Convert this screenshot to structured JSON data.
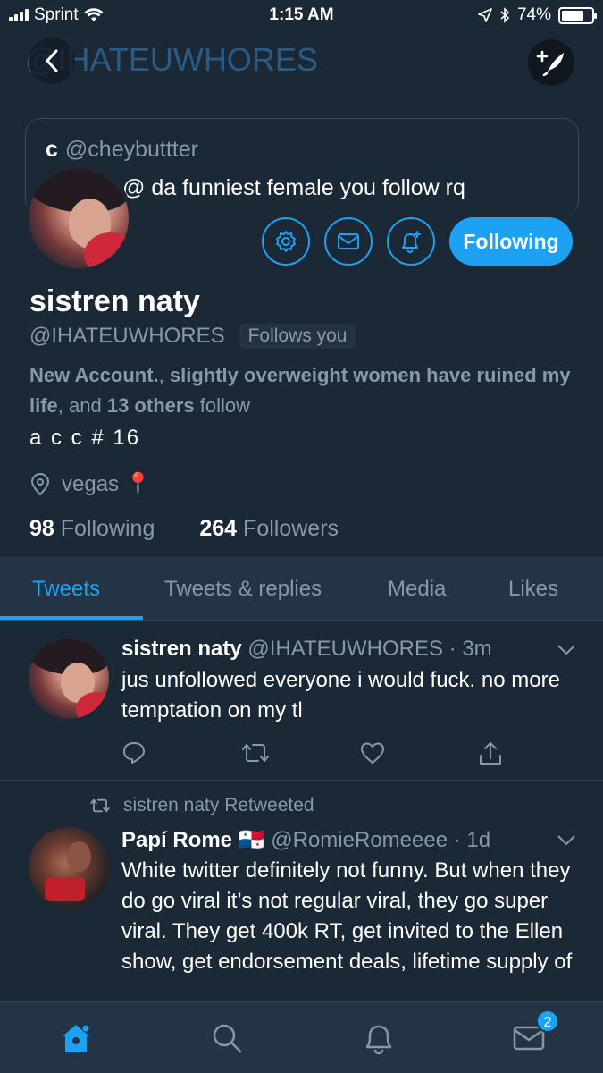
{
  "status_bar": {
    "carrier": "Sprint",
    "time": "1:15 AM",
    "battery": "74%",
    "battery_level": 0.74
  },
  "header": {
    "banner_handle": "@IHATEUWHORES",
    "quote": {
      "name": "c",
      "handle": "@cheybuttter",
      "text": "@ da funniest female you follow rq"
    }
  },
  "profile": {
    "name": "sistren naty",
    "handle": "@IHATEUWHORES",
    "follows_you": "Follows you",
    "followed_by_1": "New Account.",
    "followed_by_sep1": ", ",
    "followed_by_2": "slightly overweight women have ruined my life",
    "followed_by_sep2": ", and ",
    "followed_by_3": "13 others",
    "followed_by_suffix": " follow",
    "bio": "a c c # 16",
    "location": "vegas 📍",
    "following_count": "98",
    "following_label": "Following",
    "followers_count": "264",
    "followers_label": "Followers",
    "following_button": "Following"
  },
  "tabs": [
    {
      "label": "Tweets",
      "active": true
    },
    {
      "label": "Tweets & replies",
      "active": false
    },
    {
      "label": "Media",
      "active": false
    },
    {
      "label": "Likes",
      "active": false
    }
  ],
  "tweets": [
    {
      "name": "sistren naty",
      "handle": "@IHATEUWHORES",
      "time": "3m",
      "text": "jus unfollowed everyone i would fuck. no more temptation on my tl"
    },
    {
      "retweeted_by": "sistren naty Retweeted",
      "name": "Papí Rome",
      "flag": "🇵🇦",
      "handle": "@RomieRomeeee",
      "time": "1d",
      "text": "White twitter definitely not funny. But when they do go viral it’s not regular viral, they go super viral. They get 400k RT, get invited to the Ellen show, get endorsement deals, lifetime supply of"
    }
  ],
  "bottom_nav": {
    "messages_badge": "2"
  },
  "colors": {
    "accent": "#1da1f2",
    "background": "#1b2836",
    "muted": "#8899a6"
  }
}
